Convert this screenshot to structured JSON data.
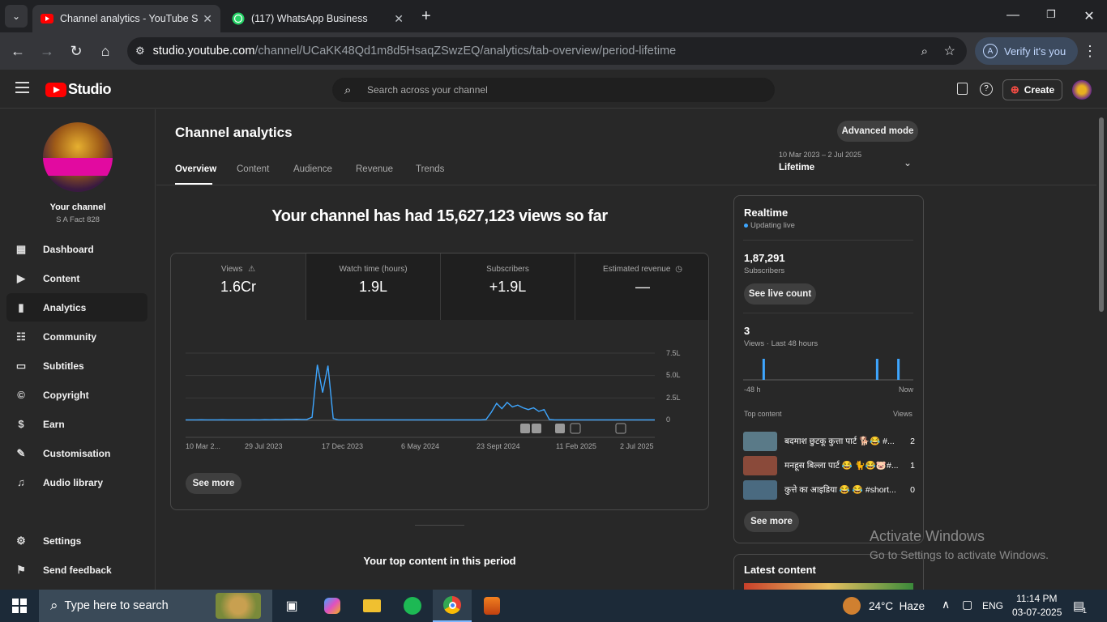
{
  "browser": {
    "tabs": [
      {
        "title": "Channel analytics - YouTube Stu",
        "active": true
      },
      {
        "title": "(117) WhatsApp Business",
        "active": false
      }
    ],
    "url_domain": "studio.youtube.com",
    "url_path": "/channel/UCaKK48Qd1m8d5HsaqZSwzEQ/analytics/tab-overview/period-lifetime",
    "verify_label": "Verify it's you",
    "verify_avatar": "A"
  },
  "header": {
    "logo_text": "Studio",
    "search_placeholder": "Search across your channel",
    "create_label": "Create"
  },
  "sidebar": {
    "channel_label": "Your channel",
    "channel_name": "S A Fact 828",
    "items": [
      {
        "label": "Dashboard",
        "icon": "dashboard-icon"
      },
      {
        "label": "Content",
        "icon": "content-icon"
      },
      {
        "label": "Analytics",
        "icon": "analytics-icon",
        "active": true
      },
      {
        "label": "Community",
        "icon": "community-icon"
      },
      {
        "label": "Subtitles",
        "icon": "subtitles-icon"
      },
      {
        "label": "Copyright",
        "icon": "copyright-icon"
      },
      {
        "label": "Earn",
        "icon": "earn-icon"
      },
      {
        "label": "Customisation",
        "icon": "customisation-icon"
      },
      {
        "label": "Audio library",
        "icon": "audio-library-icon"
      }
    ],
    "settings": "Settings",
    "feedback": "Send feedback"
  },
  "main": {
    "title": "Channel analytics",
    "advanced_mode": "Advanced mode",
    "tabs": [
      "Overview",
      "Content",
      "Audience",
      "Revenue",
      "Trends"
    ],
    "date_range": "10 Mar 2023 – 2 Jul 2025",
    "period": "Lifetime",
    "headline": "Your channel has had 15,627,123 views so far",
    "metrics": [
      {
        "label": "Views",
        "value": "1.6Cr",
        "icon": "warning-icon"
      },
      {
        "label": "Watch time (hours)",
        "value": "1.9L"
      },
      {
        "label": "Subscribers",
        "value": "+1.9L"
      },
      {
        "label": "Estimated revenue",
        "value": "—",
        "icon": "clock-icon"
      }
    ],
    "see_more": "See more",
    "top_content_title": "Your top content in this period"
  },
  "chart_data": {
    "type": "line",
    "series": [
      {
        "values": [
          0.05,
          0.05,
          0.05,
          0.06,
          0.05,
          0.05,
          0.05,
          0.06,
          0.05,
          0.05,
          0.05,
          0.05,
          0.05,
          0.06,
          0.05,
          0.07,
          0.06,
          0.08,
          0.07,
          0.1,
          0.1,
          0.12,
          0.1,
          0.1,
          0.35,
          6.2,
          3.1,
          6.1,
          0.2,
          0.05,
          0.05,
          0.05,
          0.05,
          0.05,
          0.05,
          0.05,
          0.05,
          0.05,
          0.05,
          0.05,
          0.05,
          0.05,
          0.05,
          0.05,
          0.05,
          0.05,
          0.05,
          0.05,
          0.05,
          0.05,
          0.05,
          0.05,
          0.05,
          0.05,
          0.05,
          0.05,
          0.05,
          0.1,
          0.9,
          1.9,
          1.3,
          2.0,
          1.5,
          1.7,
          1.4,
          1.2,
          1.4,
          1.0,
          1.2,
          0.1,
          0.05,
          0.05,
          0.05,
          0.05,
          0.05,
          0.05,
          0.05,
          0.05,
          0.05,
          0.05,
          0.05,
          0.05,
          0.05,
          0.05,
          0.05,
          0.05,
          0.05,
          0.05,
          0.05,
          0.05
        ]
      }
    ],
    "x_ticks": [
      "10 Mar 2...",
      "29 Jul 2023",
      "17 Dec 2023",
      "6 May 2024",
      "23 Sept 2024",
      "11 Feb 2025",
      "2 Jul 2025"
    ],
    "y_ticks": [
      "7.5L",
      "5.0L",
      "2.5L",
      "0"
    ],
    "ylim": [
      0,
      7.5
    ],
    "grid": true
  },
  "realtime": {
    "title": "Realtime",
    "status": "Updating live",
    "subscribers_value": "1,87,291",
    "subscribers_label": "Subscribers",
    "see_live_count": "See live count",
    "views_value": "3",
    "views_label": "Views · Last 48 hours",
    "axis_left": "-48 h",
    "axis_right": "Now",
    "bars": [
      0.0,
      0.0,
      0.0,
      0.0,
      0.0,
      1,
      0.0,
      0.0,
      0.0,
      0.0,
      0.0,
      0.0,
      0.0,
      0.0,
      0.0,
      0.0,
      0.0,
      0.0,
      0.0,
      0.0,
      0.0,
      0.0,
      0.0,
      0.0,
      0.0,
      0.0,
      0.0,
      0.0,
      0.0,
      0.0,
      0.0,
      0.0,
      0.0,
      0.0,
      0.0,
      0.0,
      0.0,
      1,
      0.0,
      0.0,
      0.0,
      0.0,
      0.0,
      1,
      0.0,
      0.0,
      0.0,
      0.0
    ],
    "top_content_label": "Top content",
    "views_col": "Views",
    "items": [
      {
        "title": "बदमाश छुटकू कुत्ता पार्ट 🐕😂 #...",
        "views": "2",
        "color": "#5a7a88"
      },
      {
        "title": "मनहूस बिल्ला पार्ट 😂 🐈😂🐷#...",
        "views": "1",
        "color": "#8a4a3a"
      },
      {
        "title": "कुत्ते का आइडिया 😂 😂 #short...",
        "views": "0",
        "color": "#4a6a80"
      }
    ],
    "see_more": "See more"
  },
  "latest": {
    "title": "Latest content"
  },
  "watermark": {
    "line1": "Activate Windows",
    "line2": "Go to Settings to activate Windows."
  },
  "taskbar": {
    "search_placeholder": "Type here to search",
    "weather": "24°C  Haze",
    "lang": "ENG",
    "time": "11:14 PM",
    "date": "03-07-2025",
    "notif_count": "1"
  },
  "colors": {
    "accent": "#3ea6ff",
    "chart_line": "#3ea6ff",
    "yt_red": "#ff0000"
  }
}
